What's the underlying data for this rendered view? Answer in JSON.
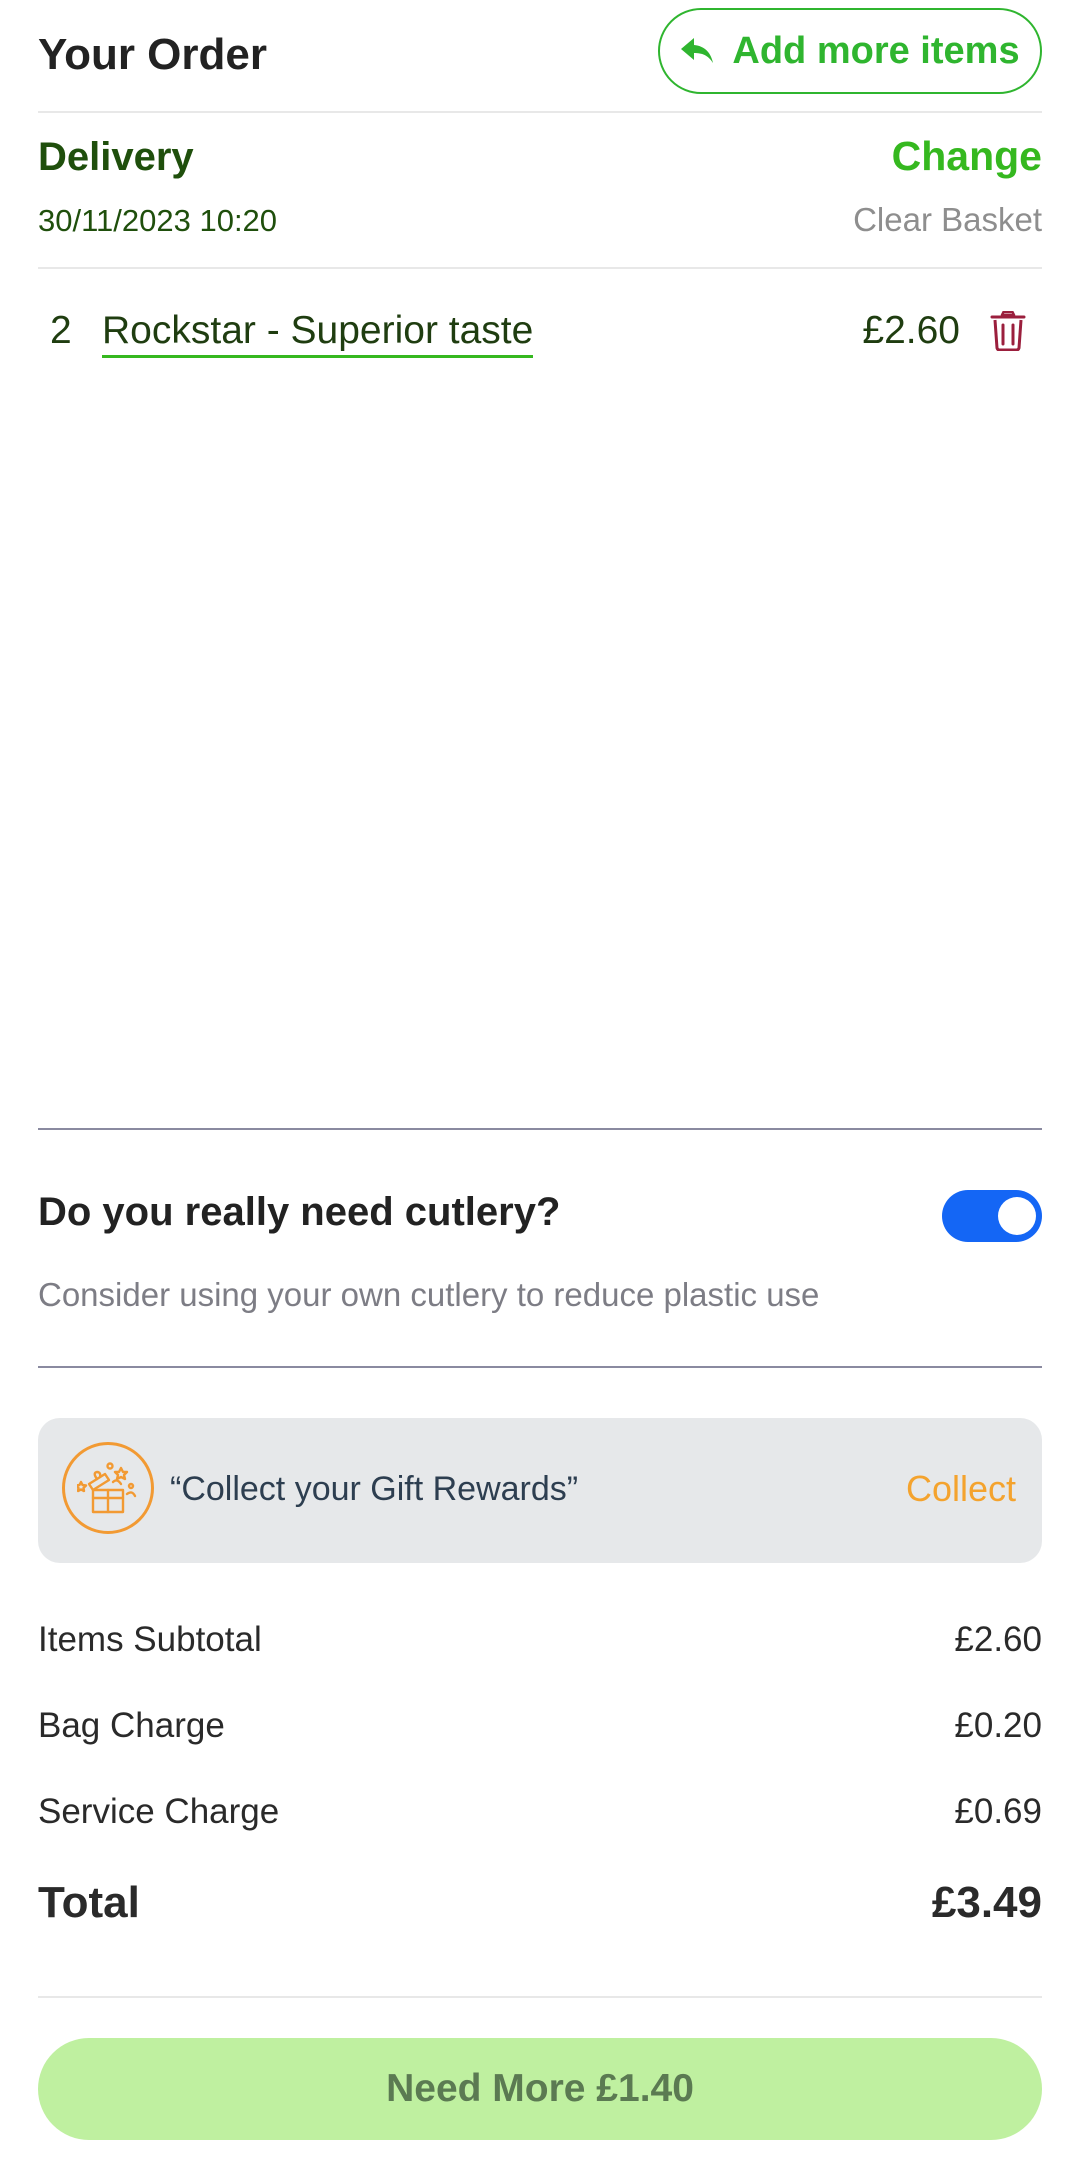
{
  "header": {
    "title": "Your Order",
    "add_more_label": "Add more items"
  },
  "delivery": {
    "label": "Delivery",
    "change_label": "Change",
    "datetime": "30/11/2023 10:20",
    "clear_label": "Clear Basket"
  },
  "items": [
    {
      "qty": "2",
      "name": "Rockstar - Superior taste",
      "price": "£2.60"
    }
  ],
  "cutlery": {
    "title": "Do you really need cutlery?",
    "subtitle": "Consider using your own cutlery to reduce plastic use",
    "toggle_on": true
  },
  "rewards": {
    "text": "“Collect your Gift Rewards”",
    "collect_label": "Collect"
  },
  "summary": {
    "subtotal_label": "Items Subtotal",
    "subtotal_value": "£2.60",
    "bag_label": "Bag Charge",
    "bag_value": "£0.20",
    "service_label": "Service Charge",
    "service_value": "£0.69",
    "total_label": "Total",
    "total_value": "£3.49"
  },
  "cta": {
    "label": "Need More £1.40"
  },
  "colors": {
    "accent_green": "#35b81f",
    "dark_green": "#1f4f0c",
    "toggle_blue": "#1466f5",
    "reward_orange": "#f4a32e",
    "trash_red": "#9b1f3d",
    "cta_bg": "#bff0a0"
  },
  "icons": {
    "back": "reply-arrow-icon",
    "trash": "trash-icon",
    "gift": "gift-icon"
  }
}
